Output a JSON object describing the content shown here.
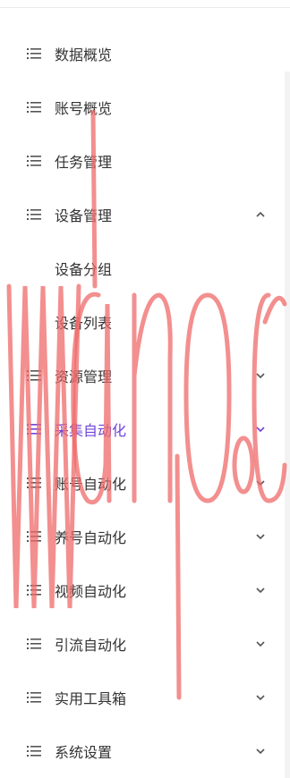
{
  "menu": {
    "items": [
      {
        "label": "数据概览",
        "icon": "list-icon",
        "chevron": null
      },
      {
        "label": "账号概览",
        "icon": "list-icon",
        "chevron": null
      },
      {
        "label": "任务管理",
        "icon": "list-icon",
        "chevron": null
      },
      {
        "label": "设备管理",
        "icon": "list-icon",
        "chevron": "chevron-up-icon"
      },
      {
        "label": "设备分组",
        "icon": null,
        "chevron": null
      },
      {
        "label": "设备列表",
        "icon": null,
        "chevron": null
      },
      {
        "label": "资源管理",
        "icon": "list-icon",
        "chevron": "chevron-down-icon"
      },
      {
        "label": "采集自动化",
        "icon": "list-icon",
        "chevron": "chevron-down-icon"
      },
      {
        "label": "账号自动化",
        "icon": "list-icon",
        "chevron": "chevron-down-icon"
      },
      {
        "label": "养号自动化",
        "icon": "list-icon",
        "chevron": "chevron-down-icon"
      },
      {
        "label": "视频自动化",
        "icon": "list-icon",
        "chevron": "chevron-down-icon"
      },
      {
        "label": "引流自动化",
        "icon": "list-icon",
        "chevron": "chevron-down-icon"
      },
      {
        "label": "实用工具箱",
        "icon": "list-icon",
        "chevron": "chevron-down-icon"
      },
      {
        "label": "系统设置",
        "icon": "list-icon",
        "chevron": "chevron-down-icon"
      }
    ]
  },
  "colors": {
    "text": "#333333",
    "active": "#6f44d8",
    "icon": "#555555",
    "watermark": "#ef6a6a"
  }
}
